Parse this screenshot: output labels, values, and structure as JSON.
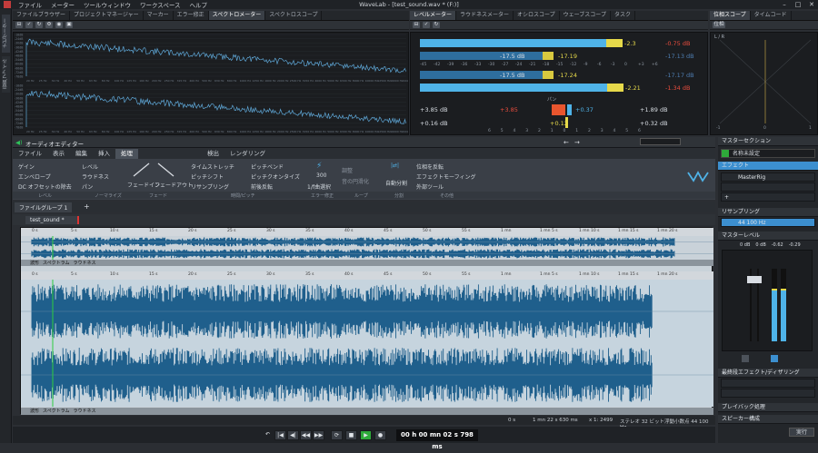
{
  "window": {
    "title": "WaveLab - [test_sound.wav * (F:)]",
    "menus": [
      "ファイル",
      "メーター",
      "ツールウィンドウ",
      "ワークスペース",
      "ヘルプ"
    ]
  },
  "left_strip": {
    "tabs": [
      "ナビゲーター",
      "音声ファイル"
    ]
  },
  "top_tabs": [
    "ファイルブラウザー",
    "プロジェクトマネージャー",
    "マーカー",
    "エラー修正",
    "スペクトロメーター",
    "スペクトロスコープ"
  ],
  "spectro": {
    "db_labels": [
      "-18dB",
      "-24dB",
      "-30dB",
      "-36dB",
      "-42dB",
      "-48dB",
      "-54dB",
      "-60dB",
      "-66dB",
      "-72dB",
      "-78dB"
    ],
    "freq_labels": [
      "20 Hz",
      "25 Hz",
      "32 Hz",
      "40 Hz",
      "50 Hz",
      "63 Hz",
      "80 Hz",
      "100 Hz",
      "125 Hz",
      "160 Hz",
      "200 Hz",
      "250 Hz",
      "315 Hz",
      "400 Hz",
      "500 Hz",
      "630 Hz",
      "800 Hz",
      "1000 Hz",
      "1250 Hz",
      "1600 Hz",
      "2000 Hz",
      "2500 Hz",
      "3150 Hz",
      "4000 Hz",
      "5000 Hz",
      "6300 Hz",
      "8000 Hz",
      "10000 Hz",
      "12500 Hz",
      "16000 Hz",
      "19474 Hz"
    ]
  },
  "meter_tabs": [
    "レベルメーター",
    "ラウドネスメーター",
    "オシロスコープ",
    "ウェーブスコープ",
    "タスク"
  ],
  "meter": {
    "scale": [
      "-45",
      "-42",
      "-39",
      "-36",
      "-33",
      "-30",
      "-27",
      "-24",
      "-21",
      "-18",
      "-15",
      "-12",
      "-9",
      "-6",
      "-3",
      "0",
      "+3",
      "+6"
    ],
    "L": {
      "peak": "-2.3",
      "rms": "-17.19",
      "rms_inner": "-17.5 dB",
      "max": "-0.75 dB",
      "max2": "-17.13 dB",
      "level": 0.9
    },
    "R": {
      "peak": "-2.21",
      "rms": "-17.24",
      "rms_inner": "-17.5 dB",
      "max": "-1.34 dB",
      "max2": "-17.17 dB",
      "level": 0.89
    },
    "pan_label": "パン",
    "pan_left": "+3.85",
    "pan_right": "+0.37",
    "pan_center": "+0.12",
    "stats": {
      "left_top": "+3.85 dB",
      "left_bottom": "+0.16 dB",
      "right_top": "+1.89 dB",
      "right_bottom": "+0.32 dB"
    },
    "pan_scale": [
      "6",
      "5",
      "4",
      "3",
      "2",
      "1",
      "0",
      "1",
      "2",
      "3",
      "4",
      "5",
      "6"
    ]
  },
  "phase_tabs": [
    "位相スコープ",
    "タイムコード"
  ],
  "phase": {
    "top_btn": "位相",
    "lr_label": "L / R",
    "axis": [
      "-1",
      "0",
      "1"
    ]
  },
  "editor": {
    "title": "オーディオエディター",
    "ribbon_tabs": [
      "ファイル",
      "表示",
      "編集",
      "挿入",
      "処理",
      "検出",
      "レンダリング"
    ],
    "items": {
      "gain": "ゲイン",
      "envelope": "エンベロープ",
      "dc": "DC オフセットの除去",
      "level": "レベル",
      "loudness": "ラウドネス",
      "pan": "パン",
      "fadein": "フェードイン",
      "fadeout": "フェードアウト",
      "timestretch": "タイムストレッチ",
      "pitchshift": "ピッチシフト",
      "resample": "リサンプリング",
      "pitchbend": "ピッチベンド",
      "pitchquantize": "ピッチクオンタイズ",
      "reverse": "前後反転",
      "tonegen": "300",
      "tonegen_label": "1/f曲選択",
      "adjust": "調整",
      "silence": "音の円滑化",
      "autosplit": "自動分割",
      "loop": "位相を反転",
      "effect_morph": "エフェクトモーフィング",
      "external": "外部ツール"
    },
    "groups": [
      "レベル",
      "ノーマライズ",
      "フェード",
      "時間/ピッチ",
      "エラー修正",
      "ループ",
      "分割",
      "その他"
    ]
  },
  "file_group": "ファイルグループ 1",
  "file_tab": "test_sound *",
  "overview_ruler": [
    "0 s",
    "5 s",
    "10 s",
    "15 s",
    "20 s",
    "25 s",
    "30 s",
    "35 s",
    "40 s",
    "45 s",
    "50 s",
    "55 s",
    "1 mn",
    "1 mn 5 s",
    "1 mn 10 s",
    "1 mn 15 s",
    "1 mn 20 s"
  ],
  "main_ruler": [
    "0 s",
    "5 s",
    "10 s",
    "15 s",
    "20 s",
    "25 s",
    "30 s",
    "35 s",
    "40 s",
    "45 s",
    "50 s",
    "55 s",
    "1 mn",
    "1 mn 5 s",
    "1 mn 10 s",
    "1 mn 15 s",
    "1 mn 20 s"
  ],
  "view_tabs": [
    "波形",
    "スペクトラム",
    "ラウドネス"
  ],
  "status": {
    "pos": "0 s",
    "length": "1 mn 22 s 630 ms",
    "zoom": "x 1: 2499",
    "format": "ステレオ 32 ビット浮動小数点 44 100 Hz"
  },
  "transport": {
    "time": "00 h 00 mn 02 s 798 ms",
    "buttons": [
      "↶",
      "|◀",
      "◀|",
      "◀◀",
      "▶▶",
      "⟳",
      "■",
      "▶",
      "●"
    ]
  },
  "master": {
    "title": "マスターセクション",
    "preset": "名称未設定",
    "effects_title": "エフェクト",
    "plugin": "MasterRig",
    "resample_title": "リサンプリング",
    "resample_value": "44 100 Hz",
    "level_title": "マスターレベル",
    "levels": [
      "0 dB",
      "0 dB",
      "-0.62",
      "-0.29"
    ],
    "final_title": "最終段エフェクト/ディザリング",
    "playback": "プレイバック処理",
    "speaker": "スピーカー構成",
    "run": "実行",
    "accent": "#2f9be0"
  }
}
